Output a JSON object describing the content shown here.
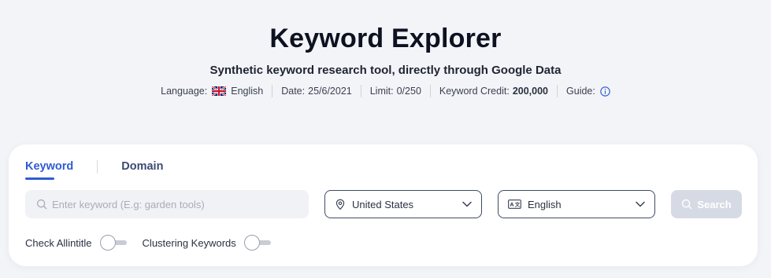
{
  "header": {
    "title": "Keyword Explorer",
    "subtitle": "Synthetic keyword research tool, directly through Google Data"
  },
  "meta": {
    "language_label": "Language:",
    "language_value": "English",
    "date_label": "Date:",
    "date_value": "25/6/2021",
    "limit_label": "Limit:",
    "limit_value": "0/250",
    "credit_label": "Keyword Credit:",
    "credit_value": "200,000",
    "guide_label": "Guide:"
  },
  "tabs": [
    {
      "label": "Keyword",
      "active": true
    },
    {
      "label": "Domain",
      "active": false
    }
  ],
  "search": {
    "placeholder": "Enter keyword (E.g: garden tools)",
    "value": ""
  },
  "country_select": {
    "selected": "United States"
  },
  "language_select": {
    "selected": "English"
  },
  "search_button": {
    "label": "Search"
  },
  "toggles": [
    {
      "label": "Check Allintitle",
      "on": false
    },
    {
      "label": "Clustering Keywords",
      "on": false
    }
  ],
  "icons": {
    "flag": "uk-flag-icon",
    "guide": "info-icon",
    "search": "search-icon",
    "location": "location-pin-icon",
    "translate": "translate-icon",
    "chevron": "chevron-down-icon"
  },
  "colors": {
    "accent": "#2f5bd3",
    "background": "#f3f4f8",
    "button_disabled": "#d6dae4"
  }
}
